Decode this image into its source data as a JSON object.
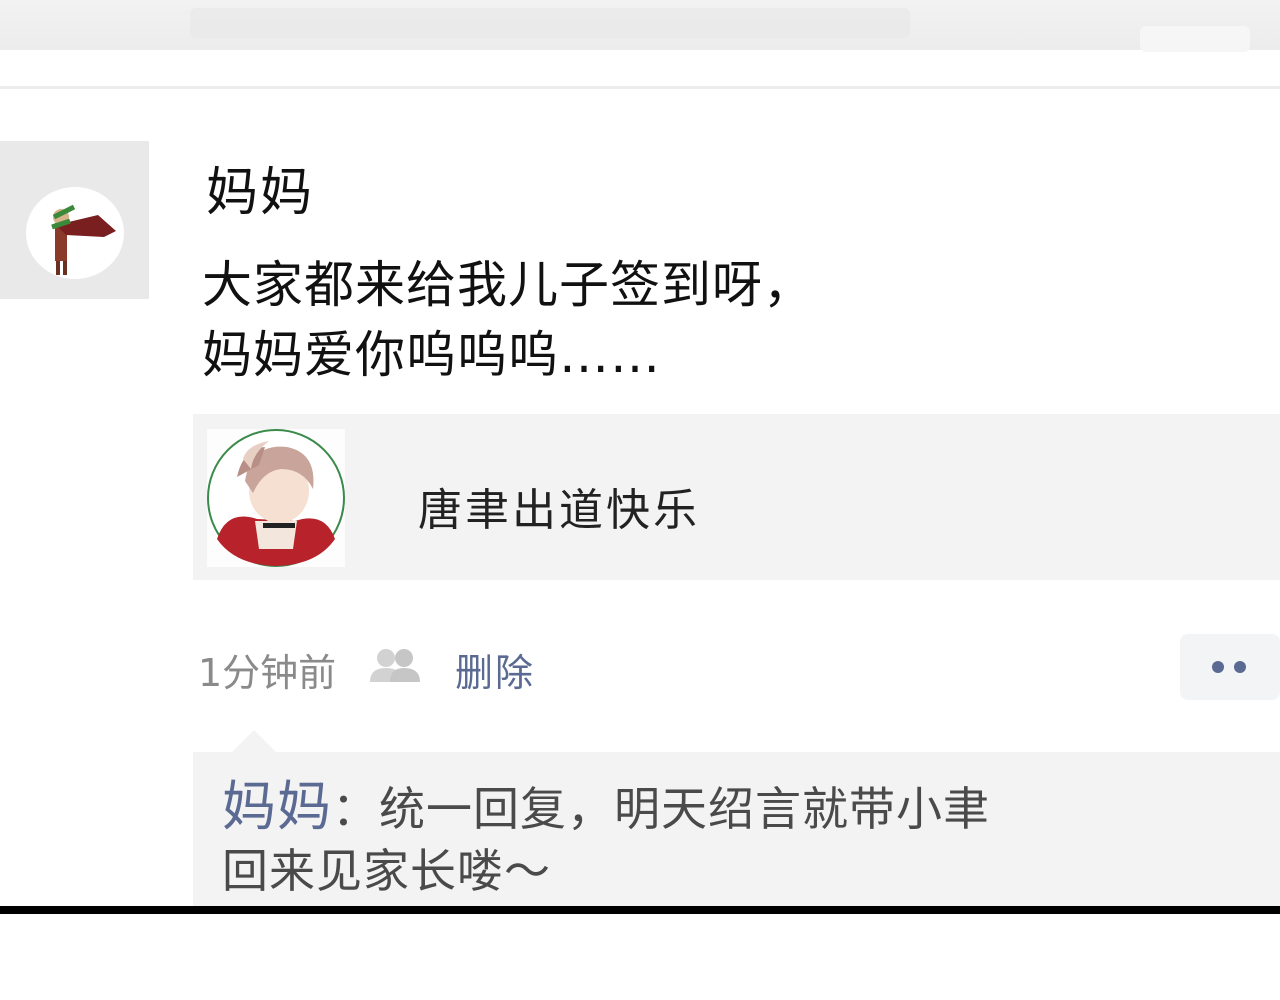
{
  "post": {
    "author": "妈妈",
    "text": "大家都来给我儿子签到呀，\n妈妈爱你呜呜呜……",
    "shared": {
      "title": "唐聿出道快乐"
    },
    "time": "1分钟前",
    "delete_label": "删除"
  },
  "comment": {
    "author": "妈妈",
    "separator": "：",
    "text": "统一回复，明天绍言就带小聿\n回来见家长喽～"
  },
  "icons": {
    "friends": "friends-visibility-icon",
    "more": "more-options-icon"
  },
  "colors": {
    "link": "#5b6a92",
    "card_bg": "#f3f3f3"
  }
}
